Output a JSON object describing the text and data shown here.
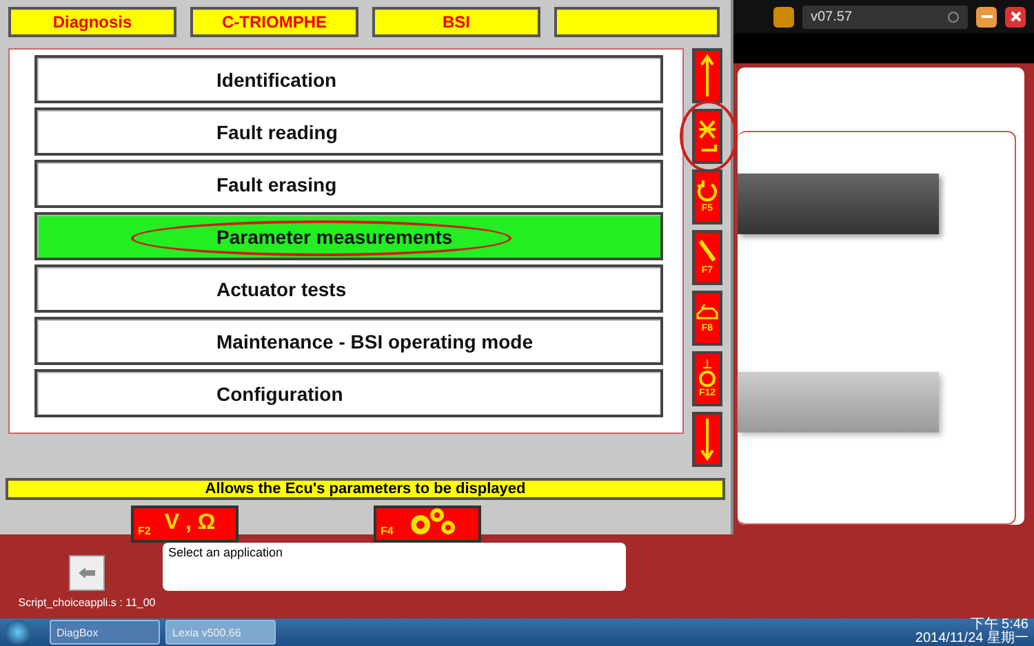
{
  "header_tabs": [
    {
      "label": "Diagnosis"
    },
    {
      "label": "C-TRIOMPHE"
    },
    {
      "label": "BSI"
    }
  ],
  "top_bar": {
    "version": "v07.57"
  },
  "menu_items": [
    {
      "label": "Identification",
      "selected": false,
      "circled": false
    },
    {
      "label": "Fault reading",
      "selected": false,
      "circled": false
    },
    {
      "label": "Fault erasing",
      "selected": false,
      "circled": false
    },
    {
      "label": "Parameter measurements",
      "selected": true,
      "circled": true
    },
    {
      "label": "Actuator tests",
      "selected": false,
      "circled": false
    },
    {
      "label": "Maintenance - BSI operating mode",
      "selected": false,
      "circled": false
    },
    {
      "label": "Configuration",
      "selected": false,
      "circled": false
    }
  ],
  "side_buttons": [
    {
      "kind": "up",
      "circled": false
    },
    {
      "kind": "validate",
      "circled": true
    },
    {
      "kind": "undo",
      "fkey": "F5",
      "circled": false
    },
    {
      "kind": "wrench",
      "fkey": "F7",
      "circled": false
    },
    {
      "kind": "vehicle",
      "fkey": "F8",
      "circled": false
    },
    {
      "kind": "reset",
      "fkey": "F12",
      "circled": false
    },
    {
      "kind": "down",
      "circled": false
    }
  ],
  "status_message": "Allows the Ecu's parameters to be displayed",
  "function_buttons": [
    {
      "kind": "measure",
      "fkey": "F2",
      "label": "V , Ω"
    },
    {
      "kind": "gears",
      "fkey": "F4"
    }
  ],
  "application_box": {
    "value": "Select an application"
  },
  "script_label": "Script_choiceappli.s : 11_00",
  "taskbar": {
    "items": [
      {
        "label": "DiagBox",
        "selected": false
      },
      {
        "label": "Lexia v500.66",
        "selected": true
      }
    ],
    "time": "下午 5:46",
    "date": "2014/11/24 星期一"
  }
}
